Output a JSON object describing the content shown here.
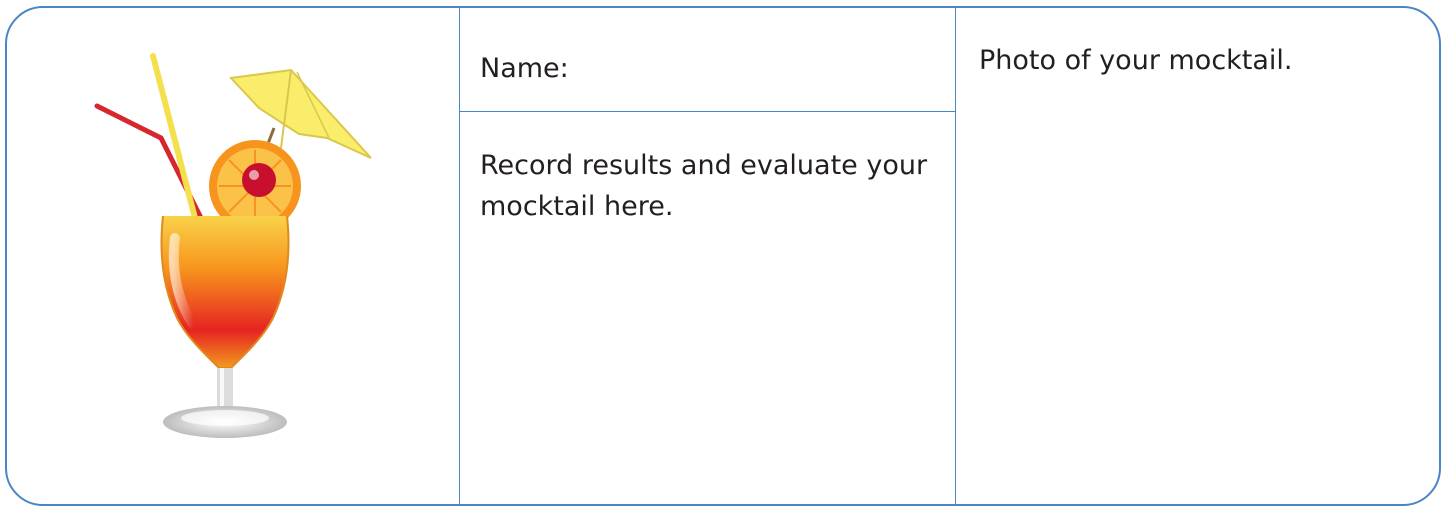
{
  "worksheet": {
    "illustration": {
      "icon": "cocktail-glass-with-umbrella-icon",
      "colors": {
        "border": "#4a86c2",
        "orange": "#f7941d",
        "red": "#e52421",
        "yellow": "#f9ed6b",
        "straw_red": "#d7262e"
      }
    },
    "name_label": "Name:",
    "record_text": "Record results and evaluate your mocktail here.",
    "photo_text": "Photo of your mocktail."
  }
}
